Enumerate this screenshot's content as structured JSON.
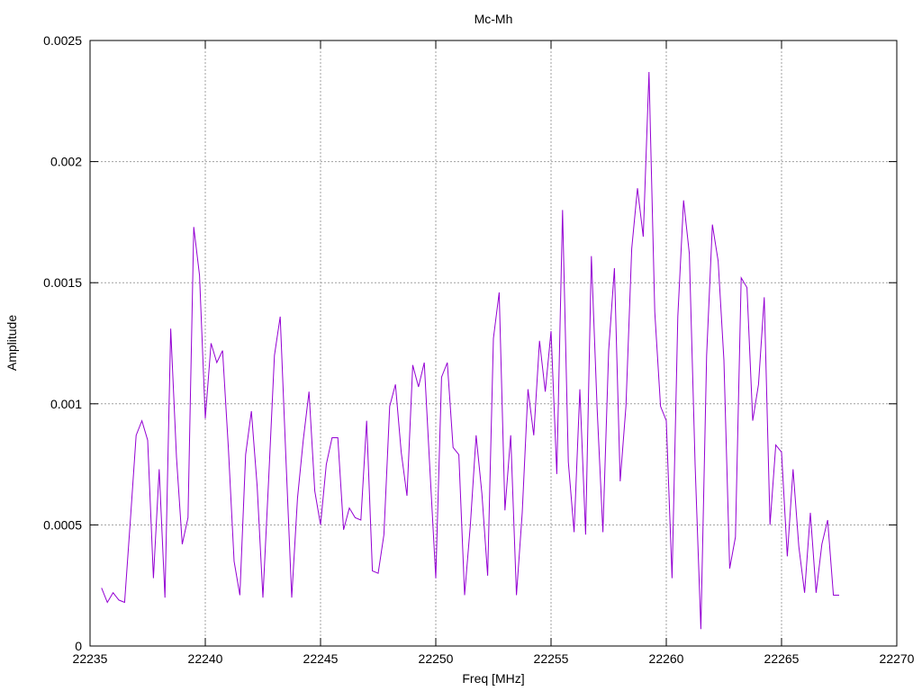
{
  "chart_data": {
    "type": "line",
    "title": "Mc-Mh",
    "xlabel": "Freq [MHz]",
    "ylabel": "Amplitude",
    "xlim": [
      22235,
      22270
    ],
    "ylim": [
      0,
      0.0025
    ],
    "xticks": [
      "22235",
      "22240",
      "22245",
      "22250",
      "22255",
      "22260",
      "22265",
      "22270"
    ],
    "yticks": [
      "0",
      "0.0005",
      "0.001",
      "0.0015",
      "0.002",
      "0.0025"
    ],
    "grid": true,
    "legend": "none",
    "line_color": "#9400d3",
    "series": [
      {
        "x": [
          22235.5,
          22235.75,
          22236.0,
          22236.25,
          22236.5,
          22236.75,
          22237.0,
          22237.25,
          22237.5,
          22237.75,
          22238.0,
          22238.25,
          22238.5,
          22238.75,
          22239.0,
          22239.25,
          22239.5,
          22239.75,
          22240.0,
          22240.25,
          22240.5,
          22240.75,
          22241.0,
          22241.25,
          22241.5,
          22241.75,
          22242.0,
          22242.25,
          22242.5,
          22242.75,
          22243.0,
          22243.25,
          22243.5,
          22243.75,
          22244.0,
          22244.25,
          22244.5,
          22244.75,
          22245.0,
          22245.25,
          22245.5,
          22245.75,
          22246.0,
          22246.25,
          22246.5,
          22246.75,
          22247.0,
          22247.25,
          22247.5,
          22247.75,
          22248.0,
          22248.25,
          22248.5,
          22248.75,
          22249.0,
          22249.25,
          22249.5,
          22249.75,
          22250.0,
          22250.25,
          22250.5,
          22250.75,
          22251.0,
          22251.25,
          22251.5,
          22251.75,
          22252.0,
          22252.25,
          22252.5,
          22252.75,
          22253.0,
          22253.25,
          22253.5,
          22253.75,
          22254.0,
          22254.25,
          22254.5,
          22254.75,
          22255.0,
          22255.25,
          22255.5,
          22255.75,
          22256.0,
          22256.25,
          22256.5,
          22256.75,
          22257.0,
          22257.25,
          22257.5,
          22257.75,
          22258.0,
          22258.25,
          22258.5,
          22258.75,
          22259.0,
          22259.25,
          22259.5,
          22259.75,
          22260.0,
          22260.25,
          22260.5,
          22260.75,
          22261.0,
          22261.25,
          22261.5,
          22261.75,
          22262.0,
          22262.25,
          22262.5,
          22262.75,
          22263.0,
          22263.25,
          22263.5,
          22263.75,
          22264.0,
          22264.25,
          22264.5,
          22264.75,
          22265.0,
          22265.25,
          22265.5,
          22265.75,
          22266.0,
          22266.25,
          22266.5,
          22266.75,
          22267.0,
          22267.25,
          22267.5
        ],
        "values": [
          0.00024,
          0.00018,
          0.00022,
          0.00019,
          0.00018,
          0.00052,
          0.00087,
          0.00093,
          0.00085,
          0.00028,
          0.00073,
          0.0002,
          0.00131,
          0.00078,
          0.00042,
          0.00053,
          0.00173,
          0.00153,
          0.00094,
          0.00125,
          0.00117,
          0.00122,
          0.00082,
          0.00035,
          0.00021,
          0.00079,
          0.00097,
          0.00066,
          0.0002,
          0.00069,
          0.0012,
          0.00136,
          0.00077,
          0.0002,
          0.00061,
          0.00085,
          0.00105,
          0.00064,
          0.0005,
          0.00075,
          0.00086,
          0.00086,
          0.00048,
          0.00057,
          0.00053,
          0.00052,
          0.00093,
          0.00031,
          0.0003,
          0.00046,
          0.00099,
          0.00108,
          0.0008,
          0.00062,
          0.00116,
          0.00107,
          0.00117,
          0.00072,
          0.00028,
          0.00111,
          0.00117,
          0.00082,
          0.00079,
          0.00021,
          0.0005,
          0.00087,
          0.00063,
          0.00029,
          0.00127,
          0.00146,
          0.00056,
          0.00087,
          0.00021,
          0.00055,
          0.00106,
          0.00087,
          0.00126,
          0.00105,
          0.0013,
          0.00071,
          0.0018,
          0.00076,
          0.00047,
          0.00106,
          0.00046,
          0.00161,
          0.00098,
          0.00047,
          0.00122,
          0.00156,
          0.00068,
          0.00099,
          0.00164,
          0.00189,
          0.00169,
          0.00237,
          0.00138,
          0.00099,
          0.00093,
          0.00028,
          0.00136,
          0.00184,
          0.00162,
          0.00075,
          7e-05,
          0.0012,
          0.00174,
          0.00159,
          0.00118,
          0.00032,
          0.00045,
          0.00152,
          0.00148,
          0.00093,
          0.00108,
          0.00144,
          0.0005,
          0.00083,
          0.0008,
          0.00037,
          0.00073,
          0.00041,
          0.00022,
          0.00055,
          0.00022,
          0.00042,
          0.00052,
          0.00021,
          0.00021
        ]
      }
    ]
  }
}
